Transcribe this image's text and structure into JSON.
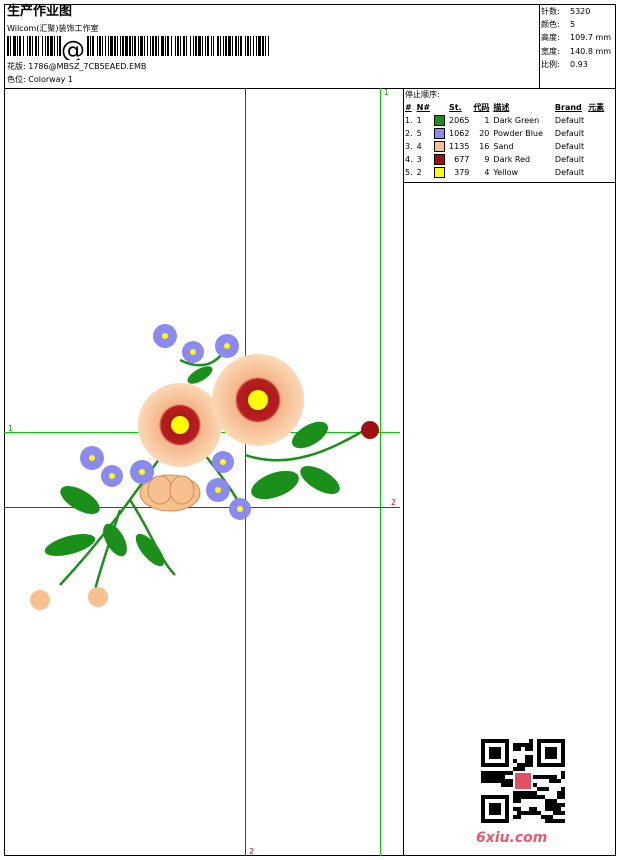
{
  "header": {
    "title": "生产作业图",
    "company": "Wilcom(汇聚)装饰工作室",
    "design_label": "花版:",
    "design_value": "1786@MBSZ_7CB5EAED.EMB",
    "colorway_label": "色位:",
    "colorway_value": "Colorway 1"
  },
  "stats": [
    {
      "label": "针数:",
      "value": "5320"
    },
    {
      "label": "颜色:",
      "value": "5"
    },
    {
      "label": "高度:",
      "value": "109.7 mm"
    },
    {
      "label": "宽度:",
      "value": "140.8 mm"
    },
    {
      "label": "比例:",
      "value": "0.93"
    }
  ],
  "sequence": {
    "title": "停止顺序:",
    "columns": [
      "#",
      "N#",
      "St.",
      "代码",
      "描述",
      "Brand",
      "元素"
    ],
    "rows": [
      {
        "idx": "1.",
        "n": "1",
        "color": "#1a8f1a",
        "st": "2065",
        "code": "1",
        "desc": "Dark Green",
        "brand": "Default"
      },
      {
        "idx": "2.",
        "n": "5",
        "color": "#8a8af0",
        "st": "1062",
        "code": "20",
        "desc": "Powder Blue",
        "brand": "Default"
      },
      {
        "idx": "3.",
        "n": "4",
        "color": "#f7c08f",
        "st": "1135",
        "code": "16",
        "desc": "Sand",
        "brand": "Default"
      },
      {
        "idx": "4.",
        "n": "3",
        "color": "#a01010",
        "st": "677",
        "code": "9",
        "desc": "Dark Red",
        "brand": "Default"
      },
      {
        "idx": "5.",
        "n": "2",
        "color": "#ffff00",
        "st": "379",
        "code": "4",
        "desc": "Yellow",
        "brand": "Default"
      }
    ]
  },
  "guides": {
    "green_1": "1",
    "red_2": "2"
  },
  "logo_text": "@",
  "site": "6xiu.com",
  "colors": {
    "guide_green": "#00cc00",
    "guide_red": "#e00000"
  }
}
